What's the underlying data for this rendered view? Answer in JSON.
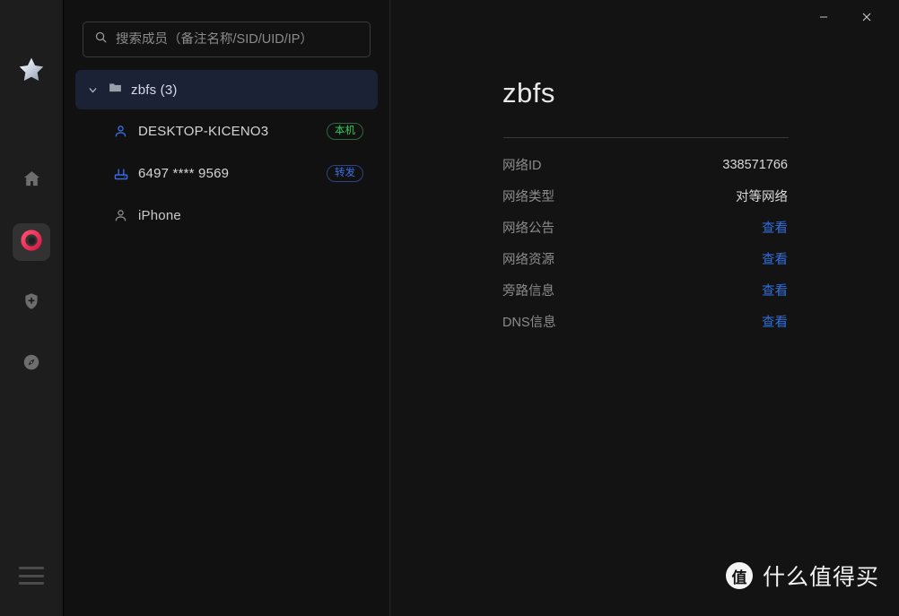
{
  "rail": {
    "star_icon": "star-icon",
    "items": [
      {
        "id": "home",
        "icon": "home-icon",
        "active": false
      },
      {
        "id": "network",
        "icon": "network-icon",
        "active": true
      },
      {
        "id": "shield",
        "icon": "shield-plus-icon",
        "active": false
      },
      {
        "id": "compass",
        "icon": "compass-icon",
        "active": false
      }
    ],
    "menu_icon": "hamburger-menu-icon"
  },
  "search": {
    "icon": "search-icon",
    "placeholder": "搜索成员（备注名称/SID/UID/IP）",
    "value": ""
  },
  "tree": {
    "group": {
      "icon": "folder-icon",
      "chevron": "chevron-down-icon",
      "label": "zbfs (3)",
      "expanded": true
    },
    "members": [
      {
        "icon": "user-icon",
        "name": "DESKTOP-KICENO3",
        "badge": "本机",
        "badge_color": "green",
        "online": true
      },
      {
        "icon": "router-icon",
        "name": "6497 **** 9569",
        "badge": "转发",
        "badge_color": "blue",
        "online": true
      },
      {
        "icon": "user-icon",
        "name": "iPhone",
        "badge": "",
        "badge_color": "",
        "online": false
      }
    ]
  },
  "titlebar": {
    "minimize_label": "—",
    "close_label": "✕"
  },
  "detail": {
    "title": "zbfs",
    "rows": [
      {
        "key": "网络ID",
        "value": "338571766",
        "type": "value"
      },
      {
        "key": "网络类型",
        "value": "对等网络",
        "type": "value"
      },
      {
        "key": "网络公告",
        "value": "查看",
        "type": "link"
      },
      {
        "key": "网络资源",
        "value": "查看",
        "type": "link"
      },
      {
        "key": "旁路信息",
        "value": "查看",
        "type": "link"
      },
      {
        "key": "DNS信息",
        "value": "查看",
        "type": "link"
      }
    ]
  },
  "watermark": {
    "logo": "值",
    "text": "什么值得买"
  },
  "colors": {
    "accent_pink": "#e8305c",
    "link_blue": "#2f6fe0",
    "badge_green": "#2ecc5a",
    "badge_blue": "#3b6fe8",
    "selected_row": "#1c2236",
    "panel_bg": "#111111",
    "rail_bg": "#1d1d1d"
  }
}
